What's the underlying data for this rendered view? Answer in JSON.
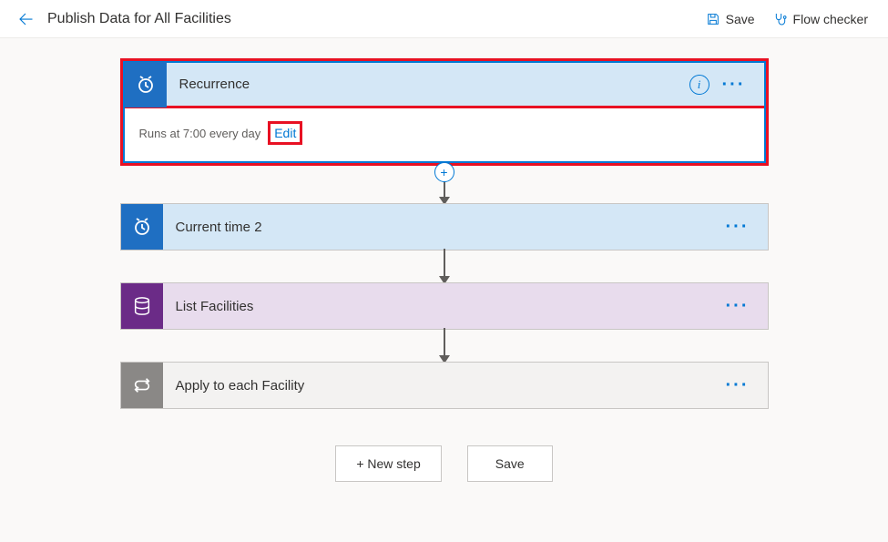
{
  "header": {
    "title": "Publish Data for All Facilities",
    "save_label": "Save",
    "checker_label": "Flow checker"
  },
  "recurrence": {
    "title": "Recurrence",
    "summary_prefix": "Runs at 7:00 every day",
    "edit_label": "Edit"
  },
  "steps": {
    "current_time": {
      "title": "Current time 2"
    },
    "list_facilities": {
      "title": "List Facilities"
    },
    "apply_each": {
      "title": "Apply to each Facility"
    }
  },
  "buttons": {
    "new_step": "+ New step",
    "save": "Save"
  }
}
